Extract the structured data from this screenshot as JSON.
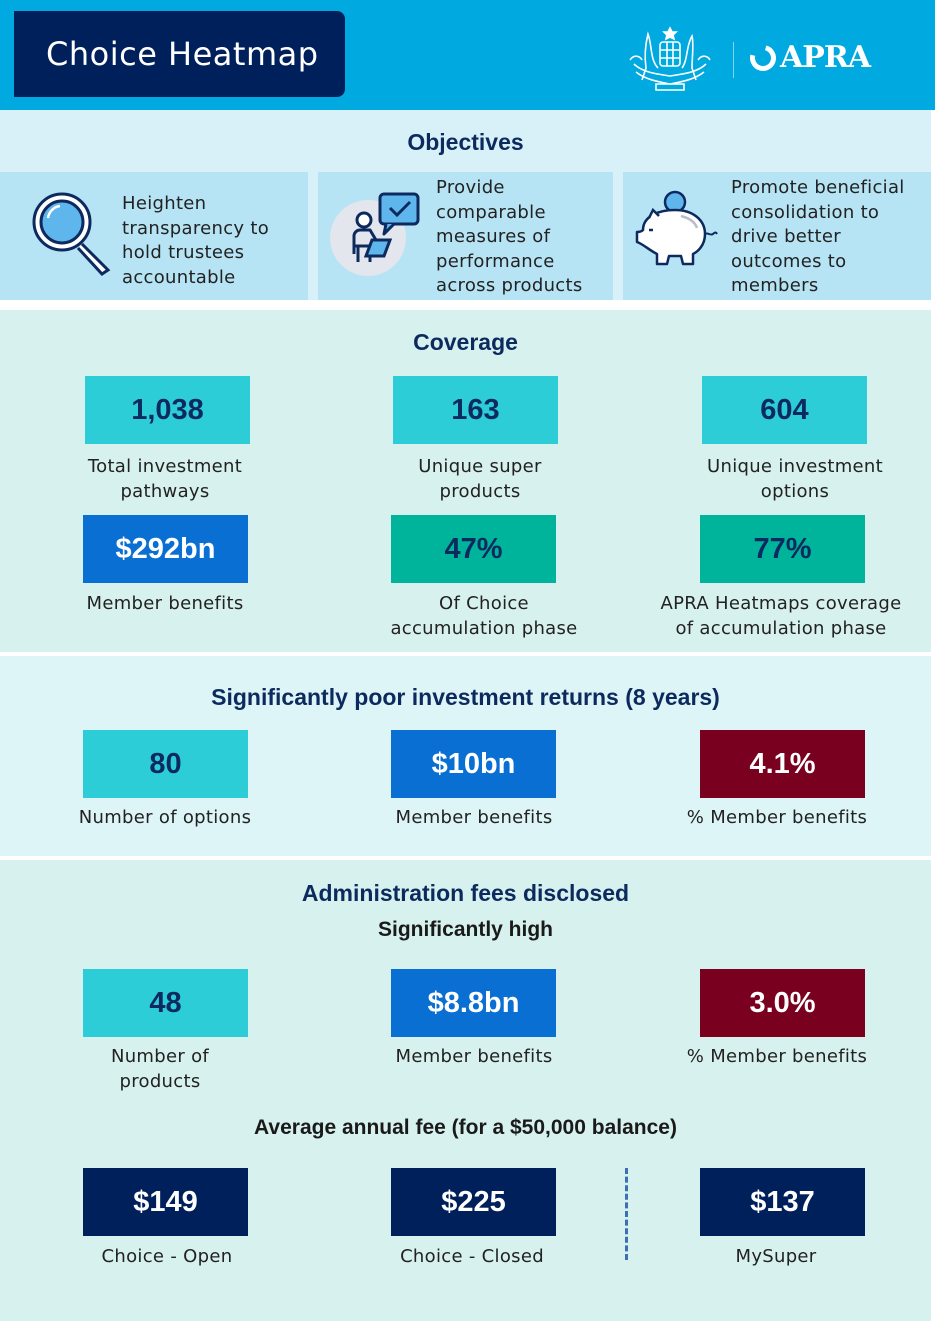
{
  "header": {
    "title": "Choice Heatmap",
    "logo_crest": "australian-coat-of-arms",
    "logo_text": "APRA",
    "colors": {
      "banner": "#00a9e0",
      "title_box": "#00205b"
    }
  },
  "objectives": {
    "title": "Objectives",
    "items": [
      {
        "icon": "magnifying-glass-icon",
        "lines": [
          "Heighten",
          "transparency to",
          "hold trustees",
          "accountable"
        ]
      },
      {
        "icon": "person-checkmark-icon",
        "lines": [
          "Provide",
          "comparable",
          "measures of",
          "performance",
          "across products"
        ]
      },
      {
        "icon": "piggy-bank-icon",
        "lines": [
          "Promote beneficial",
          "consolidation to",
          "drive better",
          "outcomes to",
          "members"
        ]
      }
    ]
  },
  "coverage": {
    "title": "Coverage",
    "stats": [
      {
        "value": "1,038",
        "label_lines": [
          "Total investment",
          "pathways"
        ],
        "color": "teal"
      },
      {
        "value": "163",
        "label_lines": [
          "Unique super",
          "products"
        ],
        "color": "teal"
      },
      {
        "value": "604",
        "label_lines": [
          "Unique investment",
          "options"
        ],
        "color": "teal"
      },
      {
        "value": "$292bn",
        "label_lines": [
          "Member benefits"
        ],
        "color": "blue"
      },
      {
        "value": "47%",
        "label_lines": [
          "Of Choice",
          "accumulation phase"
        ],
        "color": "green"
      },
      {
        "value": "77%",
        "label_lines": [
          "APRA Heatmaps coverage",
          "of accumulation phase"
        ],
        "color": "green"
      }
    ]
  },
  "poor_returns": {
    "title": "Significantly poor investment returns (8 years)",
    "stats": [
      {
        "value": "80",
        "label_lines": [
          "Number of options"
        ],
        "color": "teal"
      },
      {
        "value": "$10bn",
        "label_lines": [
          "Member benefits"
        ],
        "color": "blue"
      },
      {
        "value": "4.1%",
        "label_lines": [
          "% Member benefits"
        ],
        "color": "maroon"
      }
    ]
  },
  "admin_fees": {
    "title": "Administration fees disclosed",
    "subtitle": "Significantly high",
    "stats": [
      {
        "value": "48",
        "label_lines": [
          "Number of",
          "products"
        ],
        "color": "teal"
      },
      {
        "value": "$8.8bn",
        "label_lines": [
          "Member benefits"
        ],
        "color": "blue"
      },
      {
        "value": "3.0%",
        "label_lines": [
          "% Member benefits"
        ],
        "color": "maroon"
      }
    ],
    "avg_fee_title": "Average annual fee (for a $50,000 balance)",
    "avg_fees": [
      {
        "value": "$149",
        "label": "Choice - Open"
      },
      {
        "value": "$225",
        "label": "Choice - Closed"
      },
      {
        "value": "$137",
        "label": "MySuper"
      }
    ]
  },
  "palette": {
    "teal": "#2dcdd8",
    "blue": "#0a6fd3",
    "green": "#00b39b",
    "maroon": "#7a0020",
    "navy": "#00205b",
    "heading": "#0d2a5e"
  }
}
